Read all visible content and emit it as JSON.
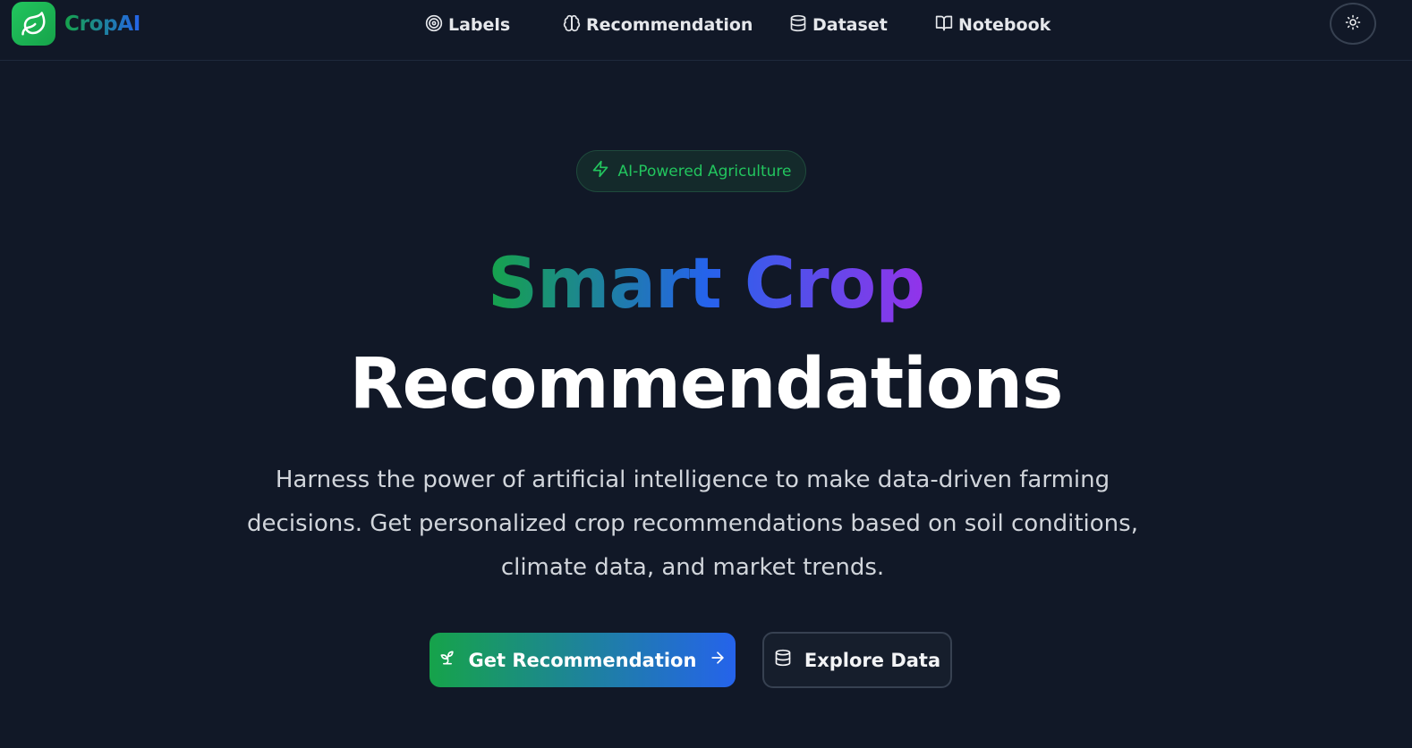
{
  "brand": {
    "name": "CropAI",
    "logo_icon": "leaf-icon"
  },
  "nav": {
    "items": [
      {
        "label": "Labels",
        "icon": "target-icon"
      },
      {
        "label": "Recommendation",
        "icon": "brain-icon"
      },
      {
        "label": "Dataset",
        "icon": "database-icon"
      },
      {
        "label": "Notebook",
        "icon": "book-open-icon"
      }
    ],
    "theme_toggle_icon": "sun-icon"
  },
  "hero": {
    "badge": {
      "label": "AI-Powered Agriculture",
      "icon": "zap-icon"
    },
    "title_line1": "Smart Crop",
    "title_line2": "Recommendations",
    "description": "Harness the power of artificial intelligence to make data-driven farming decisions. Get personalized crop recommendations based on soil conditions, climate data, and market trends.",
    "primary_cta": {
      "label": "Get Recommendation",
      "icon": "sprout-icon",
      "trailing_icon": "arrow-right-icon"
    },
    "secondary_cta": {
      "label": "Explore Data",
      "icon": "database-icon"
    }
  },
  "colors": {
    "background": "#111827",
    "accent_green": "#16a34a",
    "accent_blue": "#2563eb",
    "accent_purple": "#9333ea"
  }
}
